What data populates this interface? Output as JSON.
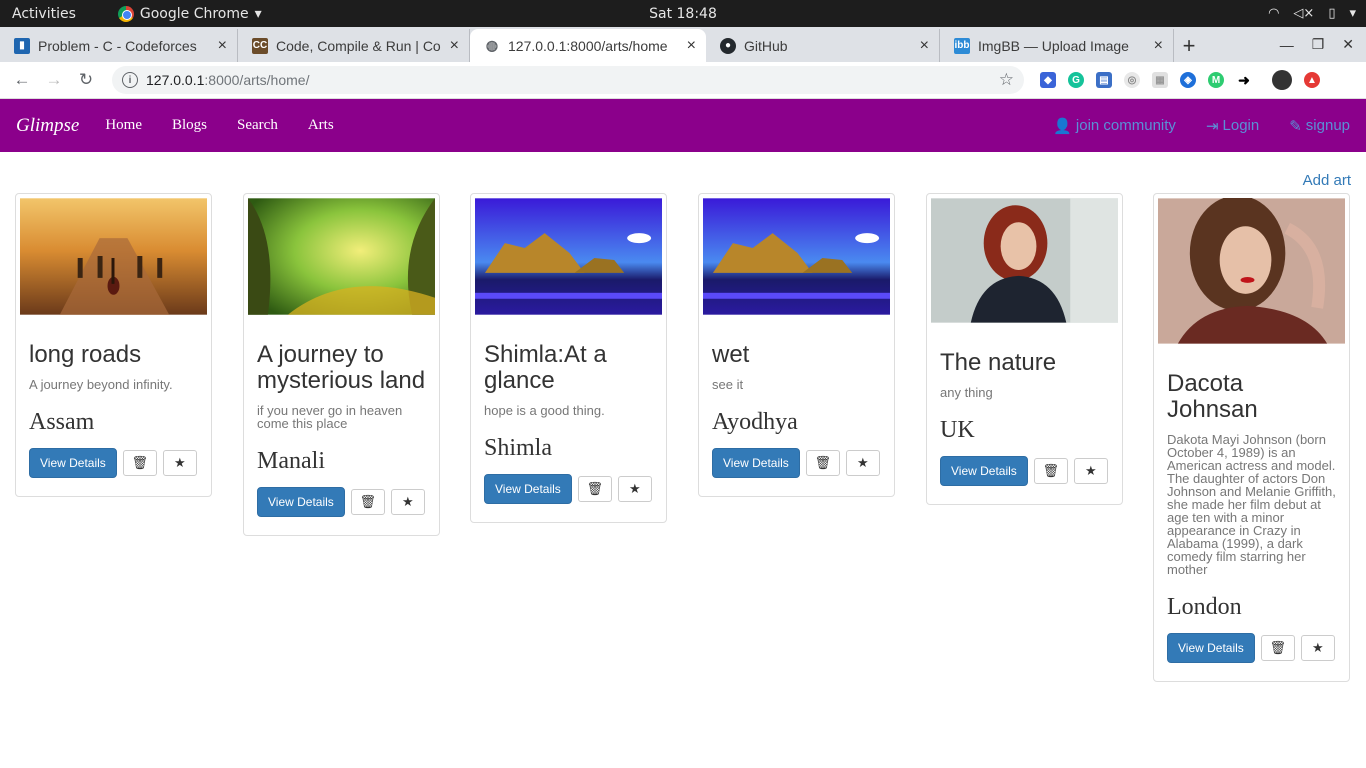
{
  "gnome": {
    "activities": "Activities",
    "app_name": "Google Chrome",
    "clock": "Sat 18:48"
  },
  "tabs": [
    {
      "title": "Problem - C - Codeforces",
      "favicon_color": "#1f66b0"
    },
    {
      "title": "Code, Compile & Run | Co",
      "favicon_color": "#6b4c2a"
    },
    {
      "title": "127.0.0.1:8000/arts/home",
      "favicon_color": "#5f6368",
      "active": true
    },
    {
      "title": "GitHub",
      "favicon_color": "#24292e"
    },
    {
      "title": "ImgBB — Upload Image",
      "favicon_color": "#2d8bd6"
    }
  ],
  "omnibox": {
    "host": "127.0.0.1",
    "path": ":8000/arts/home/"
  },
  "site": {
    "brand": "Glimpse",
    "nav": [
      "Home",
      "Blogs",
      "Search",
      "Arts"
    ],
    "right": [
      "join community",
      "Login",
      "signup"
    ],
    "add_art": "Add art",
    "colors": {
      "navbar": "#8b008b",
      "primary": "#337ab7"
    }
  },
  "cards": [
    {
      "title": "long roads",
      "description": "A journey beyond infinity.",
      "place": "Assam",
      "view": "View Details",
      "image": "road-guitar-icon"
    },
    {
      "title": "A journey to mysterious land",
      "description": "if you never go in heaven come this place",
      "place": "Manali",
      "view": "View Details",
      "image": "forest-icon"
    },
    {
      "title": "Shimla:At a glance",
      "description": "hope is a good thing.",
      "place": "Shimla",
      "view": "View Details",
      "image": "beach-icon"
    },
    {
      "title": "wet",
      "description": "see it",
      "place": "Ayodhya",
      "view": "View Details",
      "image": "beach-icon"
    },
    {
      "title": "The nature",
      "description": "any thing",
      "place": "UK",
      "view": "View Details",
      "image": "portrait-icon"
    },
    {
      "title": "Dacota Johnsan",
      "description": "Dakota Mayi Johnson (born October 4, 1989) is an American actress and model. The daughter of actors Don Johnson and Melanie Griffith, she made her film debut at age ten with a minor appearance in Crazy in Alabama (1999), a dark comedy film starring her mother",
      "place": "London",
      "view": "View Details",
      "image": "portrait-icon"
    }
  ]
}
